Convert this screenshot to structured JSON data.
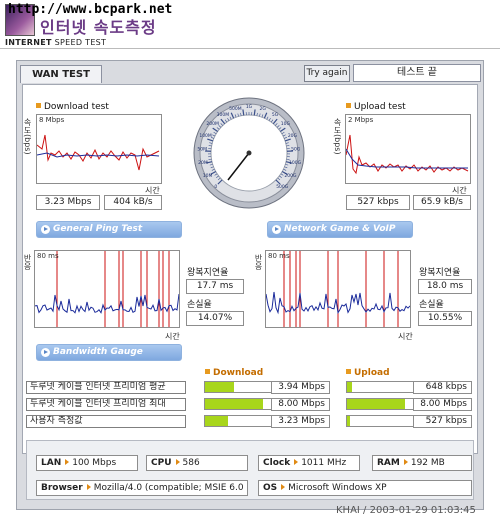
{
  "header": {
    "url": "http://www.bcpark.net",
    "korean_title": "인터넷 속도측정",
    "sub_bold": "INTERNET",
    "sub_rest": " SPEED TEST"
  },
  "tab": "WAN TEST",
  "try_again": "Try again",
  "status": "테스트 끝",
  "download": {
    "title": "Download test",
    "ylabel": "속도(bps)",
    "scale": "8 Mbps",
    "xlabel": "시간",
    "mbps": "3.23 Mbps",
    "kbs": "404 kB/s"
  },
  "upload": {
    "title": "Upload test",
    "ylabel": "속도(bps)",
    "scale": "2 Mbps",
    "xlabel": "시간",
    "kbps": "527 kbps",
    "kbs": "65.9 kB/s"
  },
  "gauge": {
    "labels": [
      "0",
      "10M",
      "20M",
      "50M",
      "100M",
      "200M",
      "300M",
      "500M",
      "1G",
      "2G",
      "5G",
      "10G",
      "20G",
      "50G",
      "100G",
      "200G",
      "500G"
    ]
  },
  "ping": {
    "title": "General Ping Test",
    "ylabel": "반응",
    "scale": "80 ms",
    "xlabel": "시간",
    "rtt_label": "왕복지연율",
    "rtt": "17.7 ms",
    "loss_label": "손실율",
    "loss": "14.07%"
  },
  "game": {
    "title": "Network Game & VoIP Test",
    "ylabel": "반응",
    "scale": "80 ms",
    "xlabel": "시간",
    "rtt_label": "왕복지연율",
    "rtt": "18.0 ms",
    "loss_label": "손실율",
    "loss": "10.55%"
  },
  "bandwidth": {
    "title": "Bandwidth Gauge",
    "download_head": "Download",
    "upload_head": "Upload",
    "rows": [
      {
        "name": "두루넷 케이블 인터넷 프리미엄 평균",
        "down": "3.94 Mbps",
        "down_fill": 0.49,
        "up": "648 kbps",
        "up_fill": 0.08
      },
      {
        "name": "두루넷 케이블 인터넷 프리미엄 최대",
        "down": "8.00 Mbps",
        "down_fill": 1.0,
        "up": "8.00 Mbps",
        "up_fill": 1.0
      },
      {
        "name": "사용자 측정값",
        "down": "3.23 Mbps",
        "down_fill": 0.4,
        "up": "527 kbps",
        "up_fill": 0.06
      }
    ]
  },
  "system": {
    "lan_label": "LAN",
    "lan": "100 Mbps",
    "cpu_label": "CPU",
    "cpu": "586",
    "clock_label": "Clock",
    "clock": "1011 MHz",
    "ram_label": "RAM",
    "ram": "192 MB",
    "browser_label": "Browser",
    "browser": "Mozilla/4.0 (compatible; MSIE 6.0",
    "os_label": "OS",
    "os": "Microsoft Windows XP"
  },
  "footer": "KHAI / 2003-01-29 01:03:45",
  "colors": {
    "accent_orange": "#e79a1f",
    "bar_green": "#a8d61b",
    "pill_blue": "#7fa8df",
    "line_red": "#cc1111",
    "line_blue": "#1a2a9a"
  }
}
